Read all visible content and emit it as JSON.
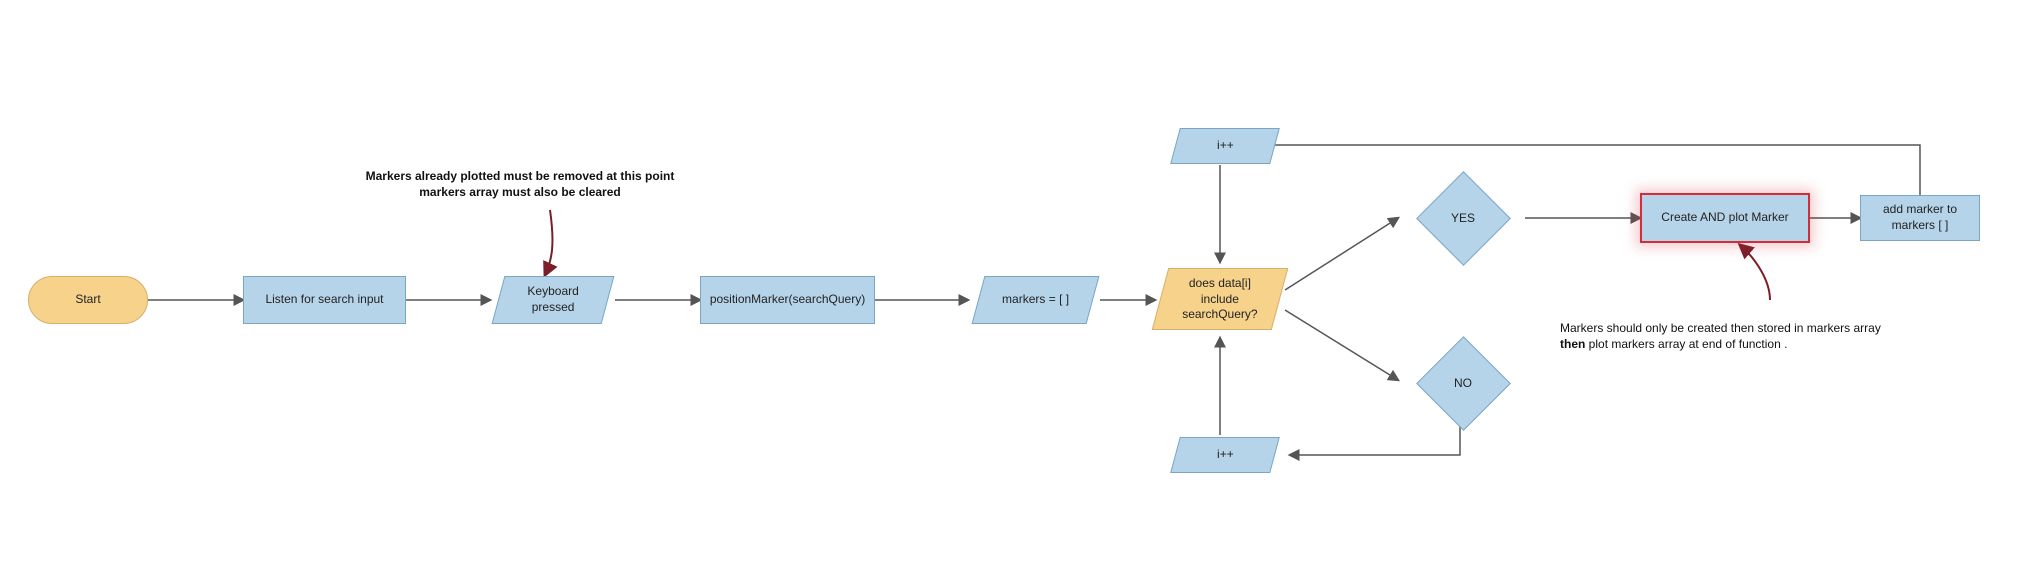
{
  "nodes": {
    "start": "Start",
    "listen": "Listen for search input",
    "keyboard": "Keyboard pressed",
    "position": "positionMarker(searchQuery)",
    "markers_init": "markers = [ ]",
    "decision": "does data[i] include searchQuery?",
    "inc_top": "i++",
    "inc_bottom": "i++",
    "yes": "YES",
    "no": "NO",
    "create_plot": "Create AND plot Marker",
    "add_marker": "add marker to markers [ ]"
  },
  "annotations": {
    "top_line1": "Markers already plotted must be removed at this point",
    "top_line2": "markers array must also be cleared",
    "bottom_line1": "Markers should only be created then stored in markers array",
    "bottom_pre": "then",
    "bottom_rest": " plot markers array at end of function ."
  },
  "colors": {
    "process_fill": "#b6d4e9",
    "terminator_fill": "#f6d28b",
    "highlight_border": "#d62c3a",
    "stroke": "#555555",
    "curve": "#7a1f2a"
  }
}
